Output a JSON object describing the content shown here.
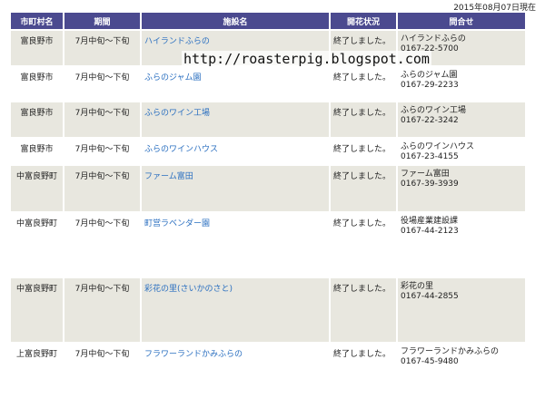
{
  "date_note": "2015年08月07日現在",
  "table": {
    "headers": [
      "市町村名",
      "期間",
      "施設名",
      "開花状況",
      "問合せ"
    ],
    "rows": [
      {
        "municipality": "富良野市",
        "period": "7月中旬〜下旬",
        "facility": "ハイランドふらの",
        "status": "終了しました。",
        "contact_name": "ハイランドふらの",
        "contact_phone": "0167-22-5700",
        "shaded": true
      },
      {
        "municipality": "富良野市",
        "period": "7月中旬〜下旬",
        "facility": "ふらのジャム園",
        "status": "終了しました。",
        "contact_name": "ふらのジャム園",
        "contact_phone": "0167-29-2233",
        "shaded": false
      },
      {
        "municipality": "富良野市",
        "period": "7月中旬〜下旬",
        "facility": "ふらのワイン工場",
        "status": "終了しました。",
        "contact_name": "ふらのワイン工場",
        "contact_phone": "0167-22-3242",
        "shaded": true
      },
      {
        "municipality": "富良野市",
        "period": "7月中旬〜下旬",
        "facility": "ふらのワインハウス",
        "status": "終了しました。",
        "contact_name": "ふらのワインハウス",
        "contact_phone": "0167-23-4155",
        "shaded": false
      },
      {
        "municipality": "中富良野町",
        "period": "7月中旬〜下旬",
        "facility": "ファーム富田",
        "status": "終了しました。",
        "contact_name": "ファーム富田",
        "contact_phone": "0167-39-3939",
        "shaded": true
      },
      {
        "municipality": "中富良野町",
        "period": "7月中旬〜下旬",
        "facility": "町営ラベンダー園",
        "status": "終了しました。",
        "contact_name": "役場産業建設課",
        "contact_phone": "0167-44-2123",
        "shaded": false
      },
      {
        "municipality": "中富良野町",
        "period": "7月中旬〜下旬",
        "facility": "彩花の里(さいかのさと)",
        "status": "終了しました。",
        "contact_name": "彩花の里",
        "contact_phone": "0167-44-2855",
        "shaded": true
      },
      {
        "municipality": "上富良野町",
        "period": "7月中旬〜下旬",
        "facility": "フラワーランドかみふらの",
        "status": "終了しました。",
        "contact_name": "フラワーランドかみふらの",
        "contact_phone": "0167-45-9480",
        "shaded": false
      }
    ]
  },
  "watermark": "http://roasterpig.blogspot.com"
}
